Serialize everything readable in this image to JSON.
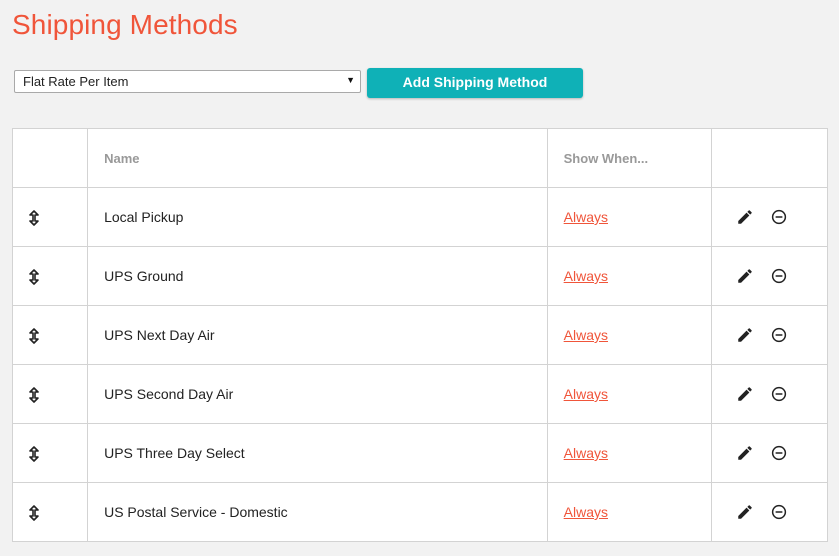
{
  "page": {
    "title": "Shipping Methods"
  },
  "toolbar": {
    "method_select": {
      "selected": "Flat Rate Per Item"
    },
    "add_button_label": "Add Shipping Method"
  },
  "table": {
    "headers": {
      "drag": "",
      "name": "Name",
      "show_when": "Show When...",
      "actions": ""
    },
    "rows": [
      {
        "name": "Local Pickup",
        "show_when": "Always"
      },
      {
        "name": "UPS Ground",
        "show_when": "Always"
      },
      {
        "name": "UPS Next Day Air",
        "show_when": "Always"
      },
      {
        "name": "UPS Second Day Air",
        "show_when": "Always"
      },
      {
        "name": "UPS Three Day Select",
        "show_when": "Always"
      },
      {
        "name": "US Postal Service - Domestic",
        "show_when": "Always"
      }
    ],
    "row_icons": {
      "drag": "sort-vertical-icon",
      "edit": "pencil-icon",
      "remove": "minus-circle-icon"
    }
  },
  "colors": {
    "accent": "#f0553a",
    "button": "#0fb1b7",
    "background": "#f2f2f2"
  }
}
